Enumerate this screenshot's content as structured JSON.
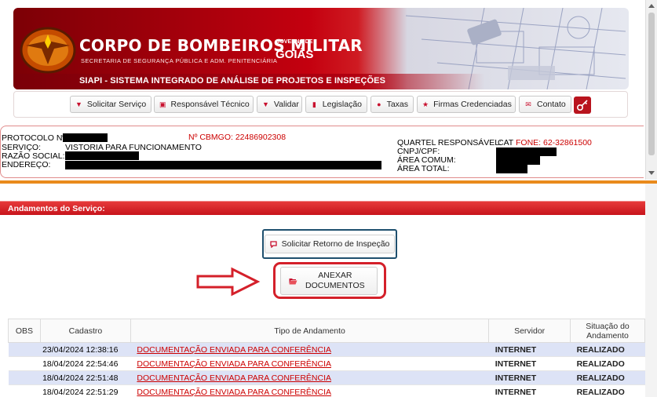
{
  "banner": {
    "title": "CORPO DE BOMBEIROS MILITAR",
    "subtitle": "SECRETARIA DE SEGURANÇA PÚBLICA E ADM. PENITENCIÁRIA",
    "gov_small": "GOVERNO DE",
    "gov_big": "GOIÁS",
    "system": "SIAPI - SISTEMA INTEGRADO DE ANÁLISE DE PROJETOS E INSPEÇÕES",
    "brand_color": "#b4000e"
  },
  "menu": [
    {
      "label": "Solicitar Serviço",
      "icon": "caret-down-icon"
    },
    {
      "label": "Responsável Técnico",
      "icon": "id-card-icon"
    },
    {
      "label": "Validar",
      "icon": "caret-down-icon"
    },
    {
      "label": "Legislação",
      "icon": "book-icon"
    },
    {
      "label": "Taxas",
      "icon": "alert-icon"
    },
    {
      "label": "Firmas Credenciadas",
      "icon": "star-icon"
    },
    {
      "label": "Contato",
      "icon": "envelope-icon"
    }
  ],
  "info": {
    "protocolo_label": "PROTOCOLO Nº:",
    "cbmgo": "Nº CBMGO: 22486902308",
    "servico_label": "SERVIÇO:",
    "servico_value": "VISTORIA PARA FUNCIONAMENTO",
    "razao_label": "RAZÃO SOCIAL:",
    "endereco_label": "ENDEREÇO:",
    "quartel_label": "QUARTEL RESPONSÁVEL:",
    "quartel_value": "CAT",
    "fone": "FONE: 62-32861500",
    "cnpj_label": "CNPJ/CPF:",
    "area_comum_label": "ÁREA COMUM:",
    "area_total_label": "ÁREA TOTAL:"
  },
  "section": {
    "title": "Andamentos do Serviço:"
  },
  "actions": {
    "retorno": "Solicitar Retorno de Inspeção",
    "anexar_line1": "ANEXAR",
    "anexar_line2": "DOCUMENTOS"
  },
  "table": {
    "headers": [
      "OBS",
      "Cadastro",
      "Tipo de Andamento",
      "Servidor",
      "Situação do Andamento"
    ],
    "rows": [
      {
        "obs": "",
        "cadastro": "23/04/2024 12:38:16",
        "tipo": "DOCUMENTAÇÃO ENVIADA PARA CONFERÊNCIA",
        "servidor": "INTERNET",
        "situacao": "REALIZADO"
      },
      {
        "obs": "",
        "cadastro": "18/04/2024 22:54:46",
        "tipo": "DOCUMENTAÇÃO ENVIADA PARA CONFERÊNCIA",
        "servidor": "INTERNET",
        "situacao": "REALIZADO"
      },
      {
        "obs": "",
        "cadastro": "18/04/2024 22:51:48",
        "tipo": "DOCUMENTAÇÃO ENVIADA PARA CONFERÊNCIA",
        "servidor": "INTERNET",
        "situacao": "REALIZADO"
      },
      {
        "obs": "",
        "cadastro": "18/04/2024 22:51:29",
        "tipo": "DOCUMENTAÇÃO ENVIADA PARA CONFERÊNCIA",
        "servidor": "INTERNET",
        "situacao": "REALIZADO"
      }
    ]
  }
}
